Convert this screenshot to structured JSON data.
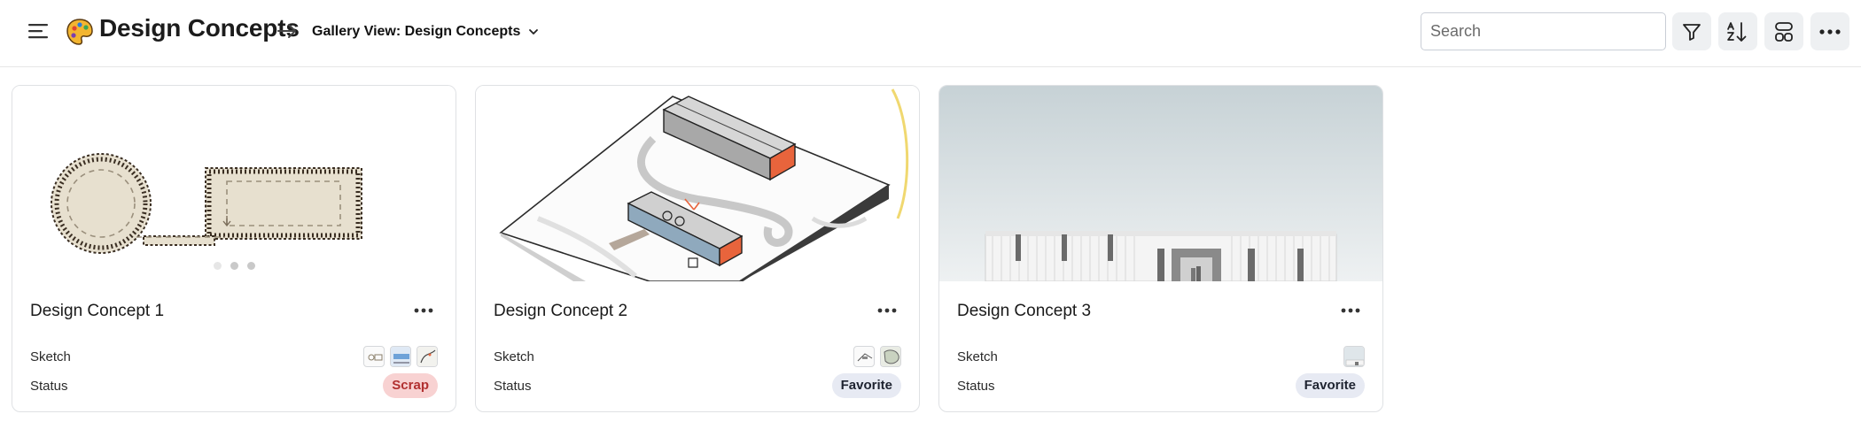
{
  "header": {
    "title": "Design Concepts",
    "view_label": "Gallery View: Design Concepts",
    "search_placeholder": "Search"
  },
  "icons": {
    "menu": "hamburger-menu-icon",
    "logo": "palette-icon",
    "arrow": "arrow-right-icon",
    "caret": "chevron-down-icon",
    "filter": "filter-icon",
    "sort": "sort-az-icon",
    "group": "group-icon",
    "more": "more-horizontal-icon"
  },
  "colors": {
    "scrap_bg": "#f8d2d2",
    "scrap_text": "#b13030",
    "favorite_bg": "#e7eaf3",
    "accent_orange": "#e8643c"
  },
  "cards": [
    {
      "title": "Design Concept 1",
      "sketch_label": "Sketch",
      "status_label": "Status",
      "status": "Scrap",
      "sketch_count": 3
    },
    {
      "title": "Design Concept 2",
      "sketch_label": "Sketch",
      "status_label": "Status",
      "status": "Favorite",
      "sketch_count": 2
    },
    {
      "title": "Design Concept 3",
      "sketch_label": "Sketch",
      "status_label": "Status",
      "status": "Favorite",
      "sketch_count": 1
    }
  ]
}
